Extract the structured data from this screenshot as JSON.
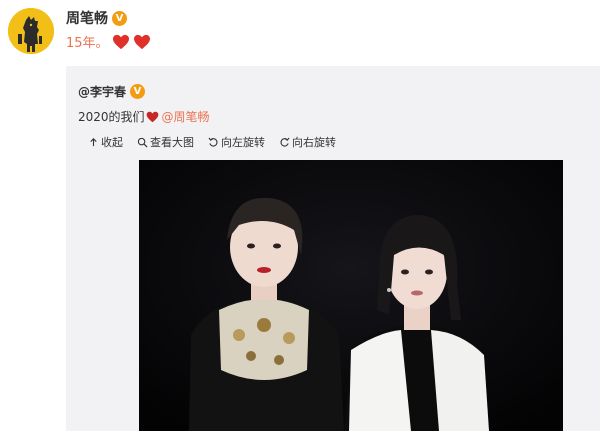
{
  "post": {
    "author": "周笔畅",
    "verified_badge": "V",
    "text": "15年。",
    "heart_color": "#e0302a",
    "text_color": "#eb7350"
  },
  "repost": {
    "author": "@李宇春",
    "verified_badge": "V",
    "text_before": "2020的我们",
    "mention": "@周笔畅",
    "toolbar": [
      {
        "icon": "collapse-icon",
        "label": "收起"
      },
      {
        "icon": "zoom-icon",
        "label": "查看大图"
      },
      {
        "icon": "rotate-left-icon",
        "label": "向左旋转"
      },
      {
        "icon": "rotate-right-icon",
        "label": "向右旋转"
      }
    ]
  }
}
